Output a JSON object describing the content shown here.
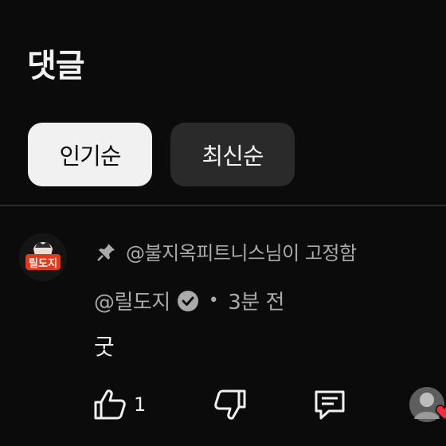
{
  "header": {
    "title": "댓글"
  },
  "sort": {
    "popular": "인기순",
    "newest": "최신순"
  },
  "comment": {
    "pinned_text": "@불지옥피트니스님이 고정함",
    "author": "@릴도지",
    "time": "3분 전",
    "separator": "•",
    "text": "굿",
    "like_count": "1",
    "avatar_text": "릴도지"
  },
  "colors": {
    "background": "#0b0b0b",
    "chip_active": "#f1f1f1",
    "chip_inactive": "#2a2a2a",
    "muted_text": "#aaaaaa",
    "avatar_accent": "#e23b1a",
    "heart": "#ff2a3a"
  },
  "icons": [
    "pin-icon",
    "verified-check-icon",
    "thumbs-up-icon",
    "thumbs-down-icon",
    "reply-icon",
    "heart-icon"
  ]
}
